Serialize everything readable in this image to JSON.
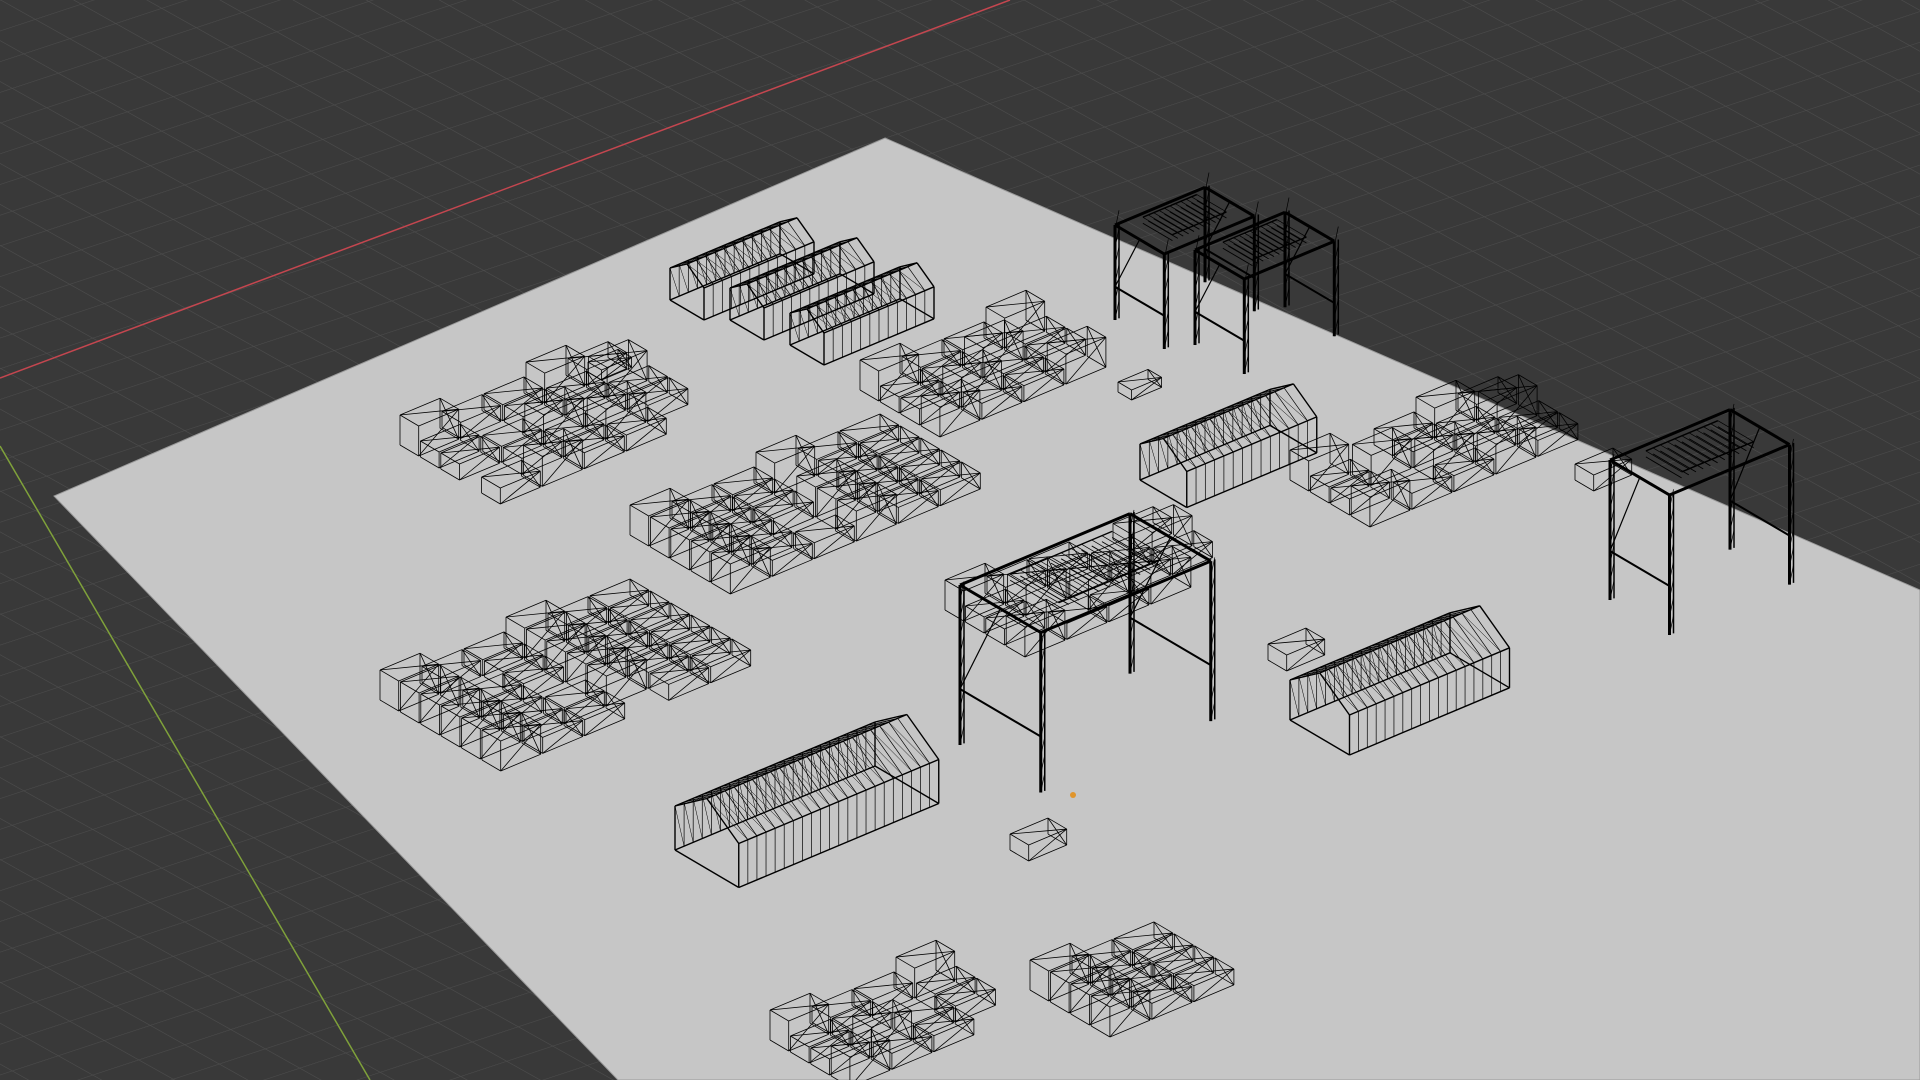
{
  "viewport": {
    "mode": "wireframe",
    "background_color": "#393939",
    "grid_color": "#4a4a4a",
    "x_axis_color": "#c4464f",
    "y_axis_color": "#7fa13a",
    "ground_plane_color": "#c6c6c6",
    "wire_color": "#000000",
    "origin_marker_color": "#e0952c"
  },
  "scene": {
    "objects": [
      {
        "type": "warehouse",
        "count": 6
      },
      {
        "type": "gantry-crane",
        "count": 4
      },
      {
        "type": "container-stack",
        "count": 9
      }
    ]
  }
}
